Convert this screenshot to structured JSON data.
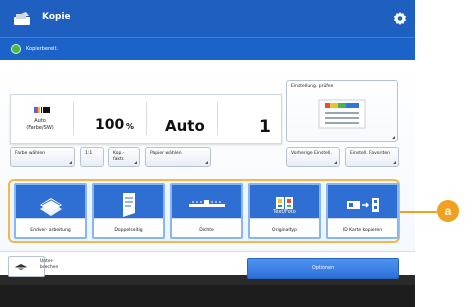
{
  "window": {
    "title": "Kopie"
  },
  "status": {
    "text": "Kopierbereit."
  },
  "settings": {
    "color_mode": "Auto (Farbe/SW)",
    "ratio_value": "100",
    "ratio_unit": "%",
    "paper": "Auto",
    "copies": "1",
    "preview_label": "Einstellung. prüfen"
  },
  "buttons": {
    "color_select": "Farbe wählen",
    "ratio_1_1": "1:1",
    "copy_ratio": "Kop.-faktr.",
    "paper_select": "Papier wählen",
    "previous": "Vorherige Einstell.",
    "favorites": "Einstell. Favoriten"
  },
  "functions": [
    {
      "label": "Endver- arbeitung",
      "icon": "finishing-icon"
    },
    {
      "label": "Doppelseitig",
      "icon": "duplex-icon"
    },
    {
      "label": "Dichte",
      "icon": "density-icon"
    },
    {
      "label": "Originaltyp",
      "icon": "original-type-icon",
      "extra": "Text/Foto"
    },
    {
      "label": "ID Karte kopieren",
      "icon": "id-card-copy-icon"
    }
  ],
  "lower": {
    "interrupt_label": "Unter- brechen",
    "options_label": "Optionen"
  },
  "callout": {
    "label": "a"
  },
  "colors": {
    "titlebar": "#1f5fbf",
    "function_button": "#2f6fd4",
    "highlight": "#f2b84d",
    "callout": "#f2a020"
  }
}
